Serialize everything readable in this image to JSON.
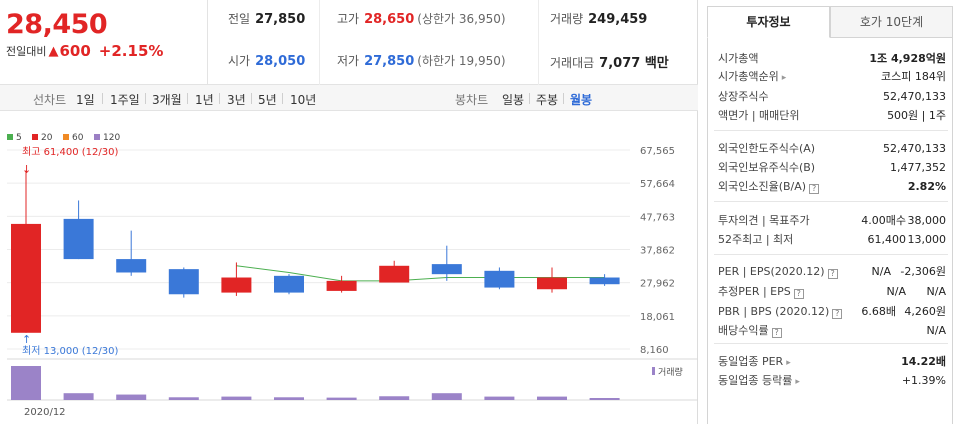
{
  "header": {
    "price": "28,450",
    "diff_label": "전일대비",
    "diff_value": "600",
    "diff_symbol": "▲",
    "diff_pct": "+2.15%"
  },
  "summary": {
    "prev_label": "전일",
    "prev_value": "27,850",
    "high_label": "고가",
    "high_value": "28,650",
    "upper_limit": "(상한가 36,950)",
    "volume_label": "거래량",
    "volume_value": "249,459",
    "open_label": "시가",
    "open_value": "28,050",
    "low_label": "저가",
    "low_value": "27,850",
    "lower_limit": "(하한가 19,950)",
    "amount_label": "거래대금",
    "amount_value": "7,077 백만"
  },
  "tabbar": {
    "line_label": "선차트",
    "periods": [
      "1일",
      "1주일",
      "3개월",
      "1년",
      "3년",
      "5년",
      "10년"
    ],
    "candle_label": "봉차트",
    "candles": [
      "일봉",
      "주봉",
      "월봉"
    ],
    "active_candle": "월봉"
  },
  "chart_data": {
    "type": "candlestick",
    "legend": [
      {
        "name": "5",
        "color": "#4caf50"
      },
      {
        "name": "20",
        "color": "#e12525"
      },
      {
        "name": "60",
        "color": "#f08a24"
      },
      {
        "name": "120",
        "color": "#9b7fc4"
      }
    ],
    "y_ticks": [
      "67,565",
      "57,664",
      "47,763",
      "37,862",
      "27,962",
      "18,061",
      "8,160"
    ],
    "ylim": [
      8160,
      67565
    ],
    "x_label": "2020/12",
    "volume_label": "거래량",
    "high_annotation": "최고 61,400 (12/30)",
    "low_annotation": "최저 13,000 (12/30)",
    "candles": [
      {
        "open": 13000,
        "close": 45500,
        "high": 61400,
        "low": 13000,
        "vol": 1.0
      },
      {
        "open": 47000,
        "close": 35000,
        "high": 52500,
        "low": 35000,
        "vol": 0.2
      },
      {
        "open": 35000,
        "close": 31000,
        "high": 43500,
        "low": 30000,
        "vol": 0.16
      },
      {
        "open": 32000,
        "close": 24500,
        "high": 32500,
        "low": 23500,
        "vol": 0.08
      },
      {
        "open": 25000,
        "close": 29500,
        "high": 34000,
        "low": 24000,
        "vol": 0.1
      },
      {
        "open": 30000,
        "close": 25000,
        "high": 30500,
        "low": 24500,
        "vol": 0.08
      },
      {
        "open": 25500,
        "close": 28500,
        "high": 30000,
        "low": 25000,
        "vol": 0.07
      },
      {
        "open": 28000,
        "close": 33000,
        "high": 34500,
        "low": 28000,
        "vol": 0.11
      },
      {
        "open": 33500,
        "close": 30500,
        "high": 39000,
        "low": 28500,
        "vol": 0.2
      },
      {
        "open": 31500,
        "close": 26500,
        "high": 32500,
        "low": 26000,
        "vol": 0.1
      },
      {
        "open": 26000,
        "close": 29500,
        "high": 32500,
        "low": 25000,
        "vol": 0.1
      },
      {
        "open": 29500,
        "close": 27500,
        "high": 30500,
        "low": 27000,
        "vol": 0.05
      }
    ],
    "ma5": [
      null,
      null,
      null,
      null,
      33000,
      31000,
      28500,
      28500,
      29500,
      29500,
      29500,
      29500
    ]
  },
  "side": {
    "tab_info": "투자정보",
    "tab_hoga": "호가 10단계",
    "market_cap_label": "시가총액",
    "market_cap_value": "1조 4,928억원",
    "market_cap_rank_label": "시가총액순위",
    "market_cap_rank_value": "코스피 184위",
    "listed_shares_label": "상장주식수",
    "listed_shares_value": "52,470,133",
    "face_value_label": "액면가 | 매매단위",
    "face_value_value": "500원 | 1주",
    "foreign_limit_label": "외국인한도주식수(A)",
    "foreign_limit_value": "52,470,133",
    "foreign_hold_label": "외국인보유주식수(B)",
    "foreign_hold_value": "1,477,352",
    "foreign_ratio_label": "외국인소진율(B/A)",
    "foreign_ratio_value": "2.82%",
    "opinion_label": "투자의견 | 목표주가",
    "opinion_value": "4.00매수",
    "target_value": "38,000",
    "week52_label": "52주최고 | 최저",
    "week52_high": "61,400",
    "week52_low": "13,000",
    "per_label": "PER | EPS(2020.12)",
    "per_value": "N/A",
    "eps_value": "-2,306원",
    "est_per_label": "추정PER | EPS",
    "est_per_value": "N/A",
    "est_eps_value": "N/A",
    "pbr_label": "PBR | BPS (2020.12)",
    "pbr_value": "6.68배",
    "bps_value": "4,260원",
    "dividend_label": "배당수익률",
    "dividend_value": "N/A",
    "industry_per_label": "동일업종 PER",
    "industry_per_value": "14.22배",
    "industry_rate_label": "동일업종 등락률",
    "industry_rate_value": "+1.39%"
  }
}
